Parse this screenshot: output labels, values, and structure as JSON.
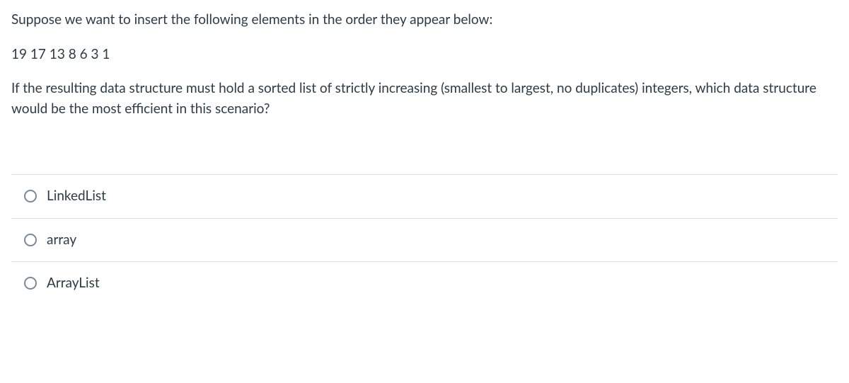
{
  "question": {
    "paragraph1": "Suppose we want to insert the following elements in the order they appear below:",
    "paragraph2": "19 17 13 8 6 3 1",
    "paragraph3": "If the resulting data structure must hold a sorted list of strictly increasing (smallest to largest, no duplicates) integers, which data structure would be the most efficient in this scenario?"
  },
  "options": [
    {
      "label": "LinkedList"
    },
    {
      "label": "array"
    },
    {
      "label": "ArrayList"
    }
  ]
}
